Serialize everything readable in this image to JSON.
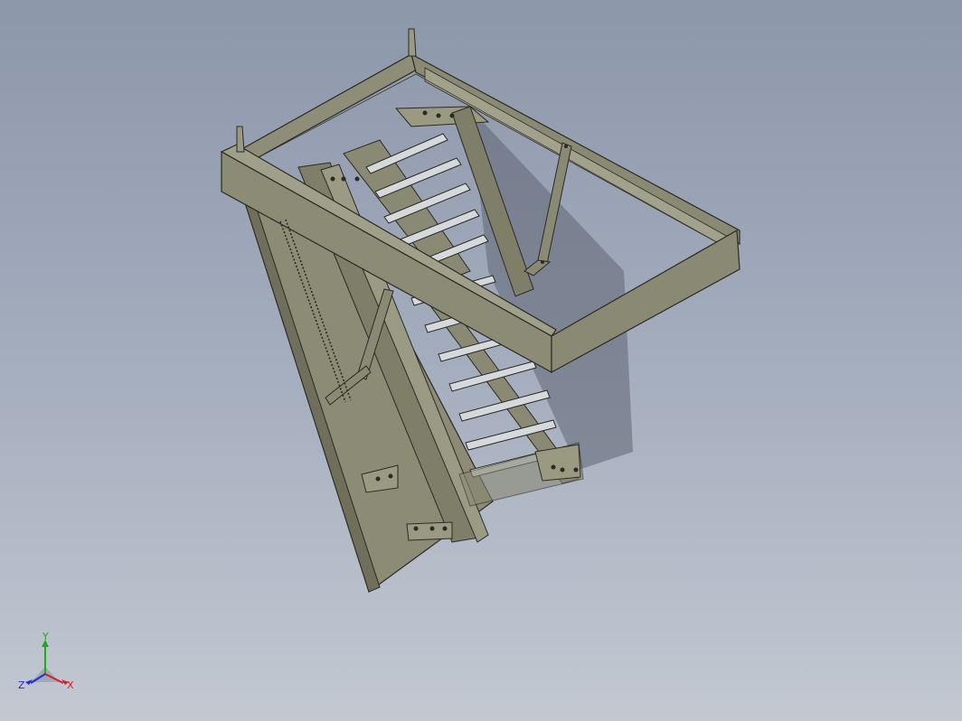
{
  "viewport": {
    "model_description_visible": false,
    "colors": {
      "background_top": "#8d97aa",
      "background_bottom": "#c3c8d1",
      "part_face": "#8a8a74",
      "part_top": "#9a9a83",
      "part_dark": "#6d6d5a",
      "edge": "#2a2a24",
      "rung": "#d6d9dc"
    }
  },
  "triad": {
    "x_label": "X",
    "y_label": "Y",
    "z_label": "Z",
    "x_color": "#d42020",
    "y_color": "#1fa81f",
    "z_color": "#2030d0"
  }
}
